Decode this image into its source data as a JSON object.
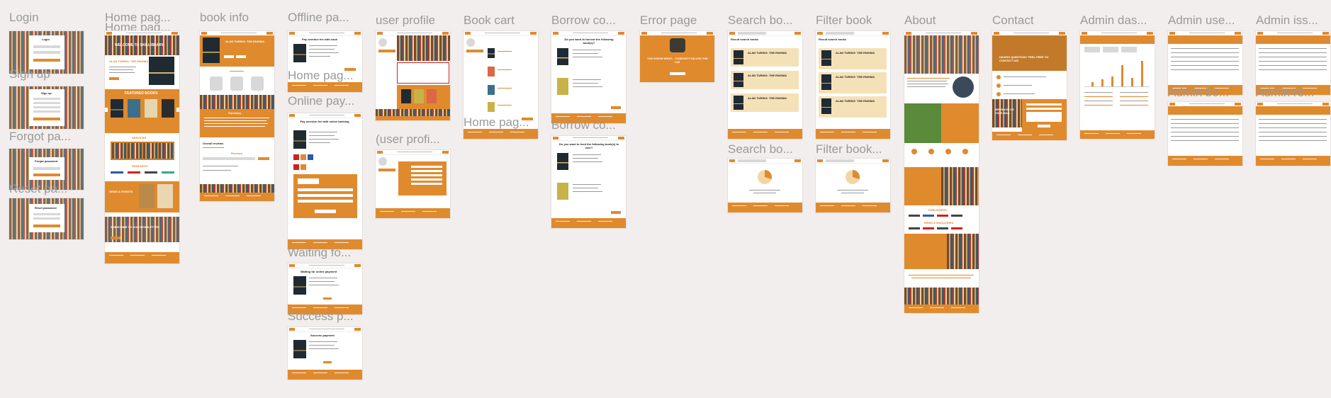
{
  "frames": {
    "login": "Login",
    "signup": "Sign up",
    "forgot": "Forgot pa...",
    "reset": "Reset pa...",
    "home1": "Home pag...",
    "home2": "Home pag...",
    "book_info": "book info",
    "offline": "Offline pa...",
    "home_pag": "Home pag...",
    "online": "Online pay...",
    "waiting": "Waiting fo...",
    "success": "Success p...",
    "user_profile": "user profile",
    "user_profile2": "(user profi...",
    "book_cart": "Book cart",
    "home_pag2": "Home pag...",
    "borrow1": "Borrow co...",
    "borrow2": "Borrow co...",
    "error": "Error page",
    "search1": "Search bo...",
    "search2": "Search bo...",
    "filter1": "Filter book",
    "filter2": "Filter book...",
    "about": "About",
    "contact": "Contact",
    "admin_das": "Admin das...",
    "admin_use": "Admin use...",
    "admin_iss": "Admin iss...",
    "admin_bo": "Admin bo...",
    "admin_re": "Admin re..."
  },
  "content": {
    "login_title": "Login",
    "signup_title": "Sign up",
    "forgot_title": "Forgot password",
    "reset_title": "Reset password",
    "welcome": "WELCOME TO SKILLIBRARY",
    "book_title": "ALAN TURING: THE ENIGMA",
    "featured": "FEATURED BOOKS",
    "services": "SERVICES",
    "research": "RESEARCH",
    "news": "NEWS & EVENTS",
    "subscribe": "SUBSCRIBE TO OUR NEWSLETTER",
    "summary": "Summary",
    "overall_reviews": "Overall reviews",
    "reviews": "Reviews",
    "offline_title": "Pay overdue fee with cash",
    "online_title": "Pay overdue fee with online banking",
    "waiting_title": "Waiting for online payment",
    "success_title": "Success payment",
    "borrow_title": "Do you want to borrow the following book(s)?",
    "lend_title": "Do you want to lend the following book(s) to user?",
    "error_text": "YOU KNOW WHAT... CURIOSITY KILLED THE CAT",
    "search_result": "Result search books",
    "about_publishers": "PUBLISHERS",
    "about_news": "NEWS & MAGAZINES",
    "contact_title": "HAVING QUESTION? FEEL FREE TO CONTACT US!",
    "contact_msg": "MESSAGE US VIA E-MAIL"
  },
  "colors": {
    "accent": "#e08a2e",
    "canvas": "#f1eeed",
    "label": "#9a9a9a"
  }
}
